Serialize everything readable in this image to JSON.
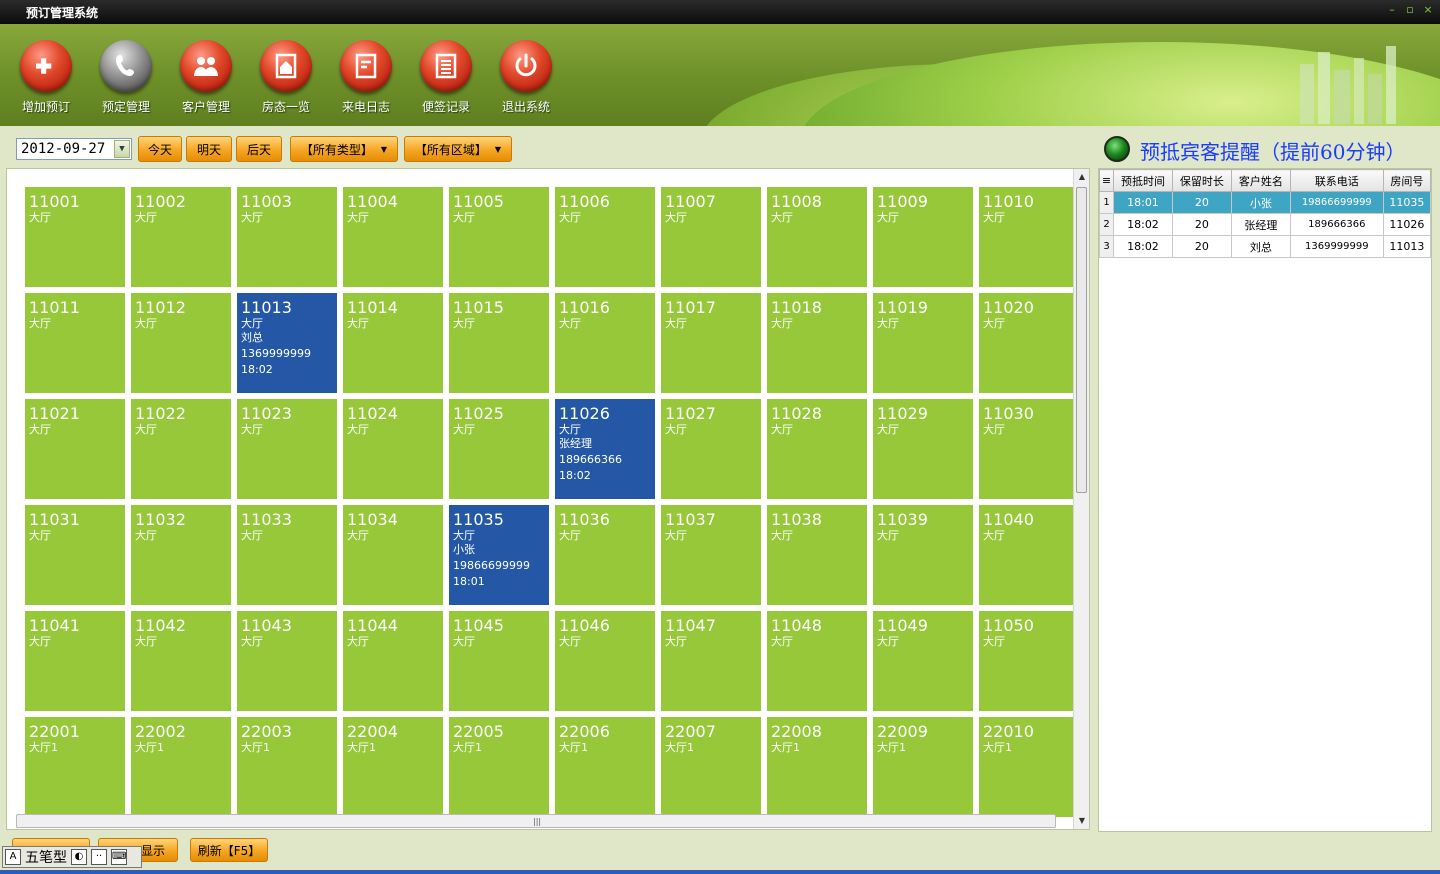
{
  "window": {
    "title": "预订管理系统",
    "minimize": "–",
    "restore": "▫",
    "close": "×"
  },
  "toolbar": [
    {
      "label": "增加预订",
      "icon": "phone-plus-icon",
      "style": "red"
    },
    {
      "label": "预定管理",
      "icon": "phone-icon",
      "style": "gray"
    },
    {
      "label": "客户管理",
      "icon": "users-icon",
      "style": "red"
    },
    {
      "label": "房态一览",
      "icon": "house-icon",
      "style": "red"
    },
    {
      "label": "来电日志",
      "icon": "log-icon",
      "style": "red"
    },
    {
      "label": "便签记录",
      "icon": "notes-icon",
      "style": "red"
    },
    {
      "label": "退出系统",
      "icon": "power-icon",
      "style": "red"
    }
  ],
  "filters": {
    "date": "2012-09-27",
    "today": "今天",
    "tomorrow": "明天",
    "day_after": "后天",
    "type_select": "【所有类型】",
    "area_select": "【所有区域】"
  },
  "reminder": {
    "title": "预抵宾客提醒（提前60分钟）",
    "columns": [
      "预抵时间",
      "保留时长",
      "客户姓名",
      "联系电话",
      "房间号"
    ],
    "rows": [
      {
        "no": "1",
        "time": "18:01",
        "hold": "20",
        "name": "小张",
        "phone": "19866699999",
        "room": "11035",
        "selected": true
      },
      {
        "no": "2",
        "time": "18:02",
        "hold": "20",
        "name": "张经理",
        "phone": "189666366",
        "room": "11026",
        "selected": false
      },
      {
        "no": "3",
        "time": "18:02",
        "hold": "20",
        "name": "刘总",
        "phone": "1369999999",
        "room": "11013",
        "selected": false
      }
    ]
  },
  "rooms": [
    {
      "num": "11001",
      "area": "大厅"
    },
    {
      "num": "11002",
      "area": "大厅"
    },
    {
      "num": "11003",
      "area": "大厅"
    },
    {
      "num": "11004",
      "area": "大厅"
    },
    {
      "num": "11005",
      "area": "大厅"
    },
    {
      "num": "11006",
      "area": "大厅"
    },
    {
      "num": "11007",
      "area": "大厅"
    },
    {
      "num": "11008",
      "area": "大厅"
    },
    {
      "num": "11009",
      "area": "大厅"
    },
    {
      "num": "11010",
      "area": "大厅"
    },
    {
      "num": "11011",
      "area": "大厅"
    },
    {
      "num": "11012",
      "area": "大厅"
    },
    {
      "num": "11013",
      "area": "大厅",
      "booked": true,
      "guest": "刘总",
      "phone": "1369999999",
      "time": "18:02"
    },
    {
      "num": "11014",
      "area": "大厅"
    },
    {
      "num": "11015",
      "area": "大厅"
    },
    {
      "num": "11016",
      "area": "大厅"
    },
    {
      "num": "11017",
      "area": "大厅"
    },
    {
      "num": "11018",
      "area": "大厅"
    },
    {
      "num": "11019",
      "area": "大厅"
    },
    {
      "num": "11020",
      "area": "大厅"
    },
    {
      "num": "11021",
      "area": "大厅"
    },
    {
      "num": "11022",
      "area": "大厅"
    },
    {
      "num": "11023",
      "area": "大厅"
    },
    {
      "num": "11024",
      "area": "大厅"
    },
    {
      "num": "11025",
      "area": "大厅"
    },
    {
      "num": "11026",
      "area": "大厅",
      "booked": true,
      "guest": "张经理",
      "phone": "189666366",
      "time": "18:02"
    },
    {
      "num": "11027",
      "area": "大厅"
    },
    {
      "num": "11028",
      "area": "大厅"
    },
    {
      "num": "11029",
      "area": "大厅"
    },
    {
      "num": "11030",
      "area": "大厅"
    },
    {
      "num": "11031",
      "area": "大厅"
    },
    {
      "num": "11032",
      "area": "大厅"
    },
    {
      "num": "11033",
      "area": "大厅"
    },
    {
      "num": "11034",
      "area": "大厅"
    },
    {
      "num": "11035",
      "area": "大厅",
      "booked": true,
      "guest": "小张",
      "phone": "19866699999",
      "time": "18:01"
    },
    {
      "num": "11036",
      "area": "大厅"
    },
    {
      "num": "11037",
      "area": "大厅"
    },
    {
      "num": "11038",
      "area": "大厅"
    },
    {
      "num": "11039",
      "area": "大厅"
    },
    {
      "num": "11040",
      "area": "大厅"
    },
    {
      "num": "11041",
      "area": "大厅"
    },
    {
      "num": "11042",
      "area": "大厅"
    },
    {
      "num": "11043",
      "area": "大厅"
    },
    {
      "num": "11044",
      "area": "大厅"
    },
    {
      "num": "11045",
      "area": "大厅"
    },
    {
      "num": "11046",
      "area": "大厅"
    },
    {
      "num": "11047",
      "area": "大厅"
    },
    {
      "num": "11048",
      "area": "大厅"
    },
    {
      "num": "11049",
      "area": "大厅"
    },
    {
      "num": "11050",
      "area": "大厅"
    },
    {
      "num": "22001",
      "area": "大厅1"
    },
    {
      "num": "22002",
      "area": "大厅1"
    },
    {
      "num": "22003",
      "area": "大厅1"
    },
    {
      "num": "22004",
      "area": "大厅1"
    },
    {
      "num": "22005",
      "area": "大厅1"
    },
    {
      "num": "22006",
      "area": "大厅1"
    },
    {
      "num": "22007",
      "area": "大厅1"
    },
    {
      "num": "22008",
      "area": "大厅1"
    },
    {
      "num": "22009",
      "area": "大厅1"
    },
    {
      "num": "22010",
      "area": "大厅1"
    }
  ],
  "bottom": {
    "btn1": "",
    "btn2": "显示",
    "refresh": "刷新【F5】",
    "ime_label": "五笔型"
  },
  "colors": {
    "room_free": "#97c83a",
    "room_booked": "#2458a6",
    "accent": "#f5a623",
    "reminder_title": "#1a3cff"
  }
}
